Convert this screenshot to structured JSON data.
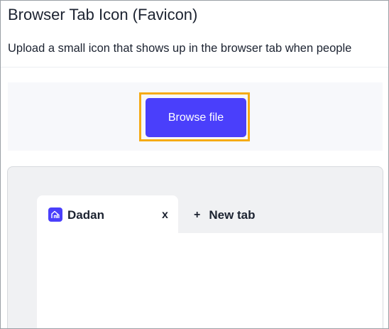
{
  "section": {
    "title": "Browser Tab Icon (Favicon)",
    "description": "Upload a small icon that shows up in the browser tab when people"
  },
  "upload": {
    "button_label": "Browse file"
  },
  "preview": {
    "active_tab": {
      "label": "Dadan",
      "close_label": "x",
      "favicon_icon": "home-logo-icon"
    },
    "new_tab": {
      "plus": "+",
      "label": "New tab"
    }
  },
  "colors": {
    "accent": "#4a3ffb",
    "highlight": "#f5ab15",
    "text": "#1c2331"
  }
}
